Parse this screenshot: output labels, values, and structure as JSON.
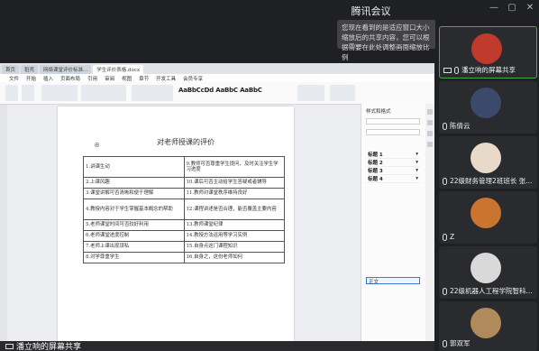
{
  "window": {
    "title": "腾讯会议",
    "controls": [
      "—",
      "▢",
      "✕"
    ]
  },
  "toast": {
    "text": "您现在看到的是适应窗口大小缩放后的共享内容，您可以根据需要在此处调整画面缩放比例"
  },
  "share": {
    "sharer_label": "潘立响的屏幕共享",
    "wps": {
      "tabs": [
        "首页",
        "稻壳",
        "网络课堂评价标准...",
        "学生评价表格.docx"
      ],
      "menus": [
        "文件",
        "开始",
        "插入",
        "页面布局",
        "引用",
        "审阅",
        "视图",
        "章节",
        "开发工具",
        "会员专享"
      ],
      "style_preview": "AaBbCcDd AaBbC AaBbC",
      "document": {
        "title": "对老师授课的评价",
        "table_rows": [
          [
            "1.讲课生动",
            "9.教师可否尊重学生提问，及时关注学生学习进度"
          ],
          [
            "2.上课风趣",
            "10.课后可否主动给学生答疑或者辅导"
          ],
          [
            "3.课堂讲解可否清晰和便于理解",
            "11.教师对课堂秩序维持良好"
          ],
          [
            "4.教授内容对于学生掌握基本概念的帮助",
            "12.课程讲述是否合理，能否覆盖主要内容"
          ],
          [
            "5.老师课堂时间可否较好利用",
            "13.教师课堂纪律"
          ],
          [
            "6.老师课堂进度控制",
            "14.教授方法运用等学习实例"
          ],
          [
            "7.老师上课出现误私",
            "15.自身点这门课程知识"
          ],
          [
            "8.对学尊重学生",
            "16.自身之，这份老师如何"
          ]
        ]
      },
      "side_panel": {
        "title": "样式和格式",
        "items": [
          "标题 1",
          "标题 2",
          "标题 3",
          "标题 4"
        ],
        "selected": "正文"
      }
    }
  },
  "participants": [
    {
      "name": "潘立响的屏幕共享",
      "avatar_color": "#c0392b",
      "active": true
    },
    {
      "name": "陈倩云",
      "avatar_color": "#3b4a6b",
      "active": false
    },
    {
      "name": "22级财务管理2班班长 张...",
      "avatar_color": "#e8d9c9",
      "active": false
    },
    {
      "name": "Z",
      "avatar_color": "#c9742f",
      "active": false
    },
    {
      "name": "22级机器人工程学院智科...",
      "avatar_color": "#d9d9d9",
      "active": false
    },
    {
      "name": "郭双军",
      "avatar_color": "#b08a5a",
      "active": false
    }
  ]
}
